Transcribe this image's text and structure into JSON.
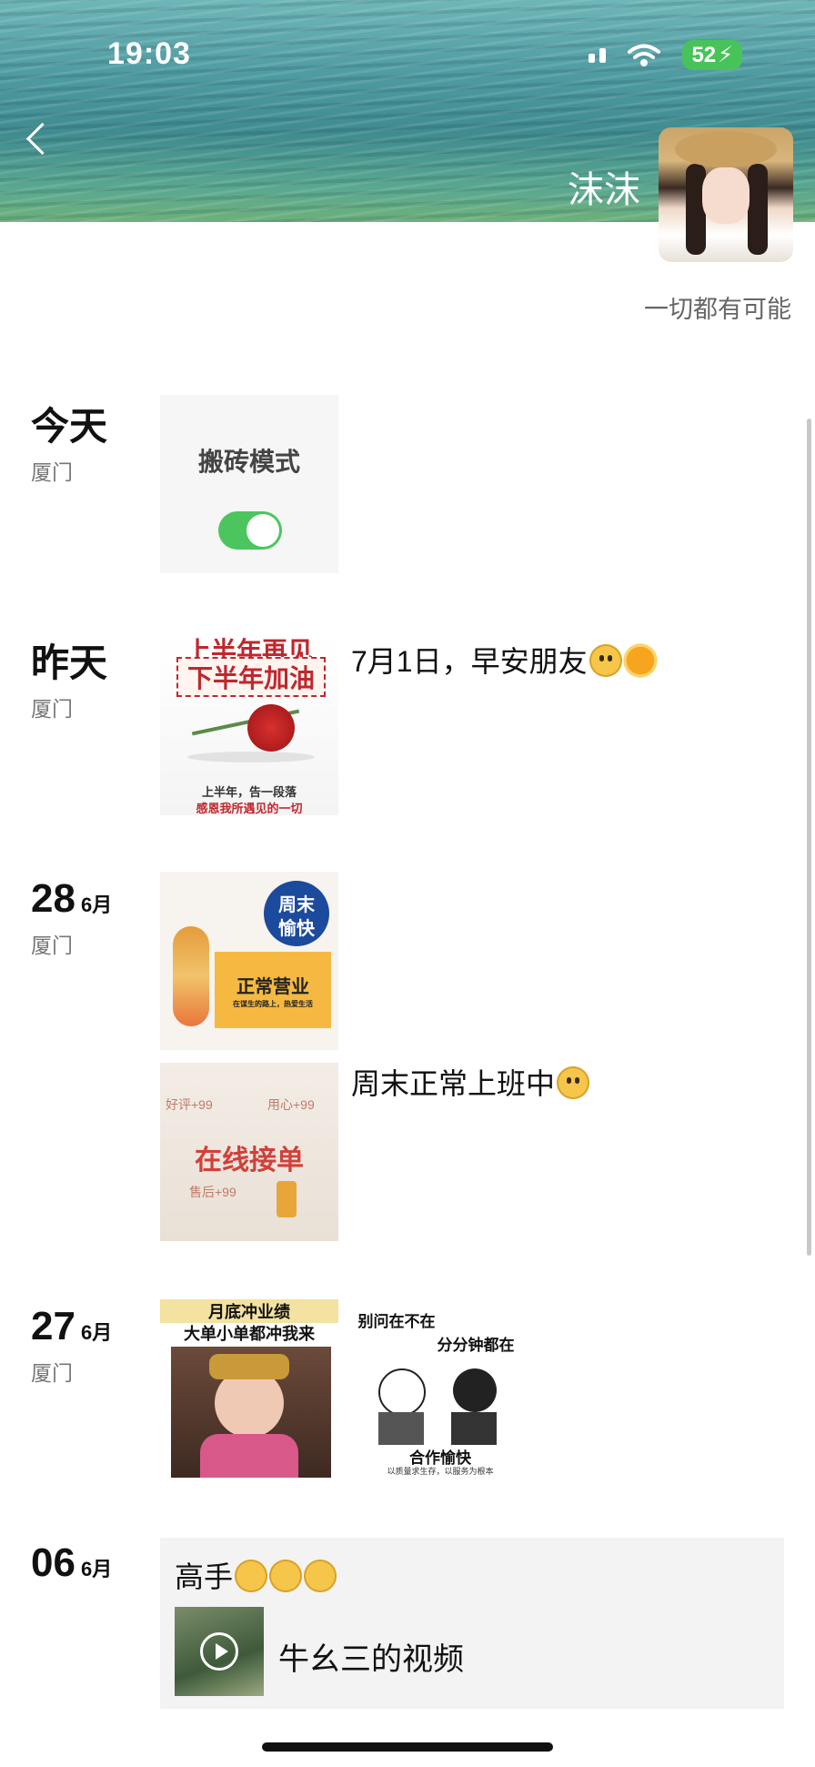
{
  "status_bar": {
    "time": "19:03",
    "battery": "52"
  },
  "profile": {
    "name": "沫沫",
    "signature": "一切都有可能"
  },
  "posts": [
    {
      "date": "今天",
      "location": "厦门",
      "card_label": "搬砖模式",
      "toggle_on": true
    },
    {
      "date": "昨天",
      "location": "厦门",
      "text": "7月1日，早安朋友",
      "image_lines": [
        "上半年再见",
        "下半年加油",
        "上半年，告一段落",
        "感恩我所遇见的一切"
      ]
    },
    {
      "day": "28",
      "month": "6月",
      "location": "厦门",
      "image1_lines": [
        "周末",
        "愉快",
        "正常营业",
        "在谋生的路上，热爱生活"
      ],
      "image2_lines": [
        "好评+99",
        "用心+99",
        "在线接单",
        "售后+99"
      ],
      "text": "周末正常上班中"
    },
    {
      "day": "27",
      "month": "6月",
      "location": "厦门",
      "image1_lines": [
        "月底冲业绩",
        "大单小单都冲我来"
      ],
      "image2_lines": [
        "别问在不在",
        "分分钟都在",
        "合作愉快",
        "以质量求生存，以服务为根本"
      ]
    },
    {
      "day": "06",
      "month": "6月",
      "text": "高手",
      "share_label": "牛幺三的视频"
    }
  ],
  "icons": [
    "back-icon",
    "signal-icon",
    "wifi-icon",
    "battery-icon",
    "play-icon"
  ]
}
